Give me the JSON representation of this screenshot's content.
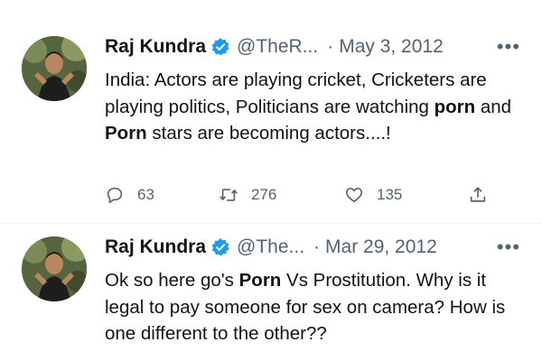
{
  "tweets": [
    {
      "author": "Raj Kundra",
      "handle": "@TheR...",
      "separator": "·",
      "date": "May 3, 2012",
      "more": "•••",
      "text": {
        "p1": "India: Actors are playing cricket,  Cricketers are playing politics,  Politicians are watching ",
        "b1": "porn",
        "p2": "  and ",
        "b2": "Porn",
        "p3": " stars are becoming actors....!"
      },
      "replies": "63",
      "retweets": "276",
      "likes": "135"
    },
    {
      "author": "Raj Kundra",
      "handle": "@The...",
      "separator": "·",
      "date": "Mar 29, 2012",
      "more": "•••",
      "text": {
        "p1": "Ok so here go's ",
        "b1": "Porn",
        "p2": " Vs Prostitution. Why is it legal to pay someone for sex on camera? How is one different to the other??"
      }
    }
  ],
  "icons": {
    "verified": "verified-badge-icon",
    "reply": "reply-icon",
    "retweet": "retweet-icon",
    "like": "heart-icon",
    "share": "share-icon"
  },
  "colors": {
    "verified": "#1d9bf0",
    "text": "#0f1419",
    "muted": "#536471"
  }
}
